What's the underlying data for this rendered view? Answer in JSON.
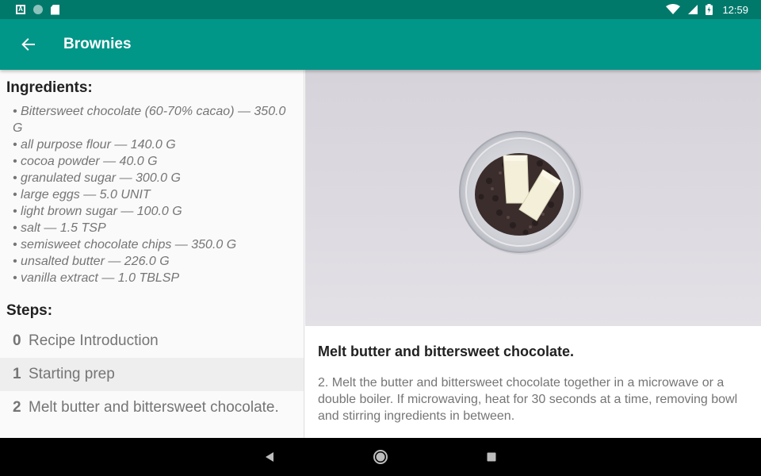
{
  "status_bar": {
    "time": "12:59",
    "left_icons": [
      "a-notification-icon",
      "circle-notification-icon",
      "sd-card-icon"
    ],
    "right_icons": [
      "wifi-icon",
      "signal-icon",
      "battery-icon"
    ]
  },
  "app_bar": {
    "title": "Brownies",
    "back_icon": "arrow-back-icon",
    "color": "#009688"
  },
  "ingredients": {
    "title": "Ingredients:",
    "items": [
      "• Bittersweet chocolate (60-70% cacao) — 350.0 G",
      "• all purpose flour — 140.0 G",
      "• cocoa powder — 40.0 G",
      "• granulated sugar — 300.0 G",
      "• large eggs — 5.0 UNIT",
      "• light brown sugar — 100.0 G",
      "• salt — 1.5 TSP",
      "• semisweet chocolate chips — 350.0 G",
      "• unsalted butter — 226.0 G",
      "• vanilla extract — 1.0 TBLSP"
    ]
  },
  "steps": {
    "title": "Steps:",
    "items": [
      {
        "number": "0",
        "label": "Recipe Introduction"
      },
      {
        "number": "1",
        "label": "Starting prep"
      },
      {
        "number": "2",
        "label": "Melt butter and bittersweet chocolate."
      }
    ],
    "selected_index": 1
  },
  "step_detail": {
    "short_description": "Melt butter and bittersweet chocolate.",
    "description": "2. Melt the butter and bittersweet chocolate together in a microwave or a double boiler. If microwaving, heat for 30 seconds at a time, removing bowl and stirring ingredients in between."
  },
  "nav_bar": {
    "buttons": [
      "back-triangle-icon",
      "home-circle-icon",
      "recents-square-icon"
    ]
  }
}
